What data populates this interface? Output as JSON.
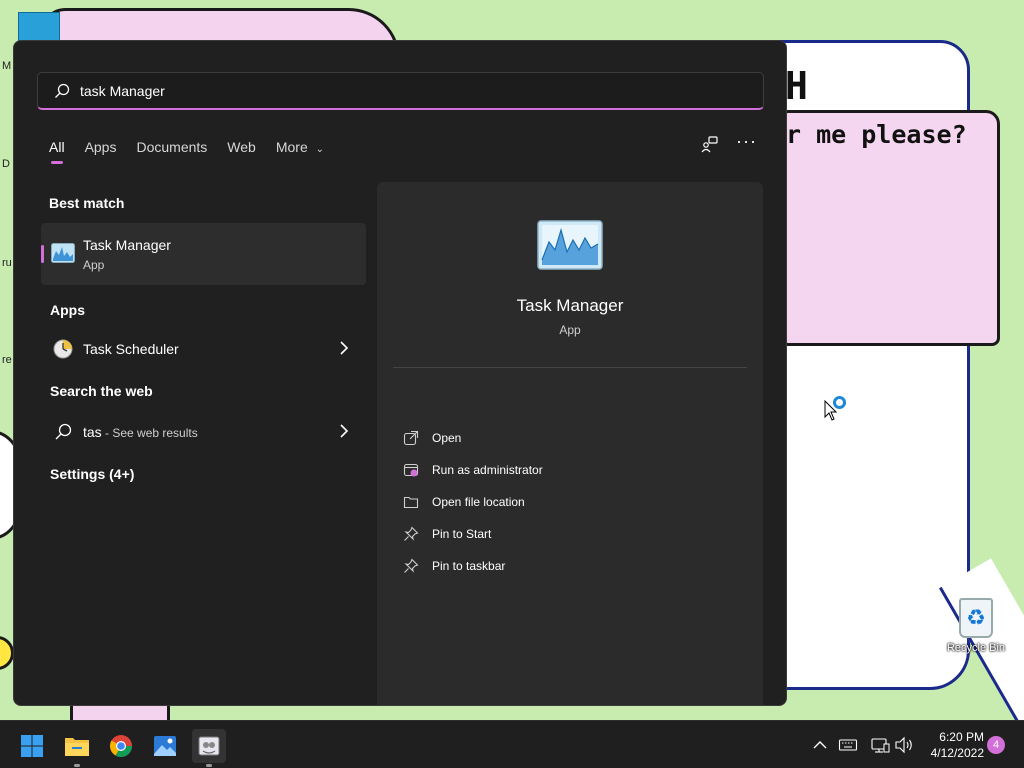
{
  "desktop": {
    "comic_heading": "H",
    "comic_line": "r me please?",
    "edge_letters": [
      "M",
      "D",
      "ru",
      "re"
    ],
    "recycle_bin_label": "Recycle Bin"
  },
  "search": {
    "query": "task Manager"
  },
  "tabs": [
    {
      "label": "All",
      "active": true
    },
    {
      "label": "Apps"
    },
    {
      "label": "Documents"
    },
    {
      "label": "Web"
    },
    {
      "label": "More"
    }
  ],
  "best_match": {
    "heading": "Best match",
    "title": "Task Manager",
    "type": "App"
  },
  "apps": {
    "heading": "Apps",
    "items": [
      {
        "label": "Task Scheduler"
      }
    ]
  },
  "web": {
    "heading": "Search the web",
    "query": "tas",
    "suffix": " - See web results"
  },
  "settings": {
    "heading": "Settings (4+)"
  },
  "detail": {
    "title": "Task Manager",
    "type": "App",
    "actions": [
      {
        "label": "Open",
        "icon": "open-external-icon"
      },
      {
        "label": "Run as administrator",
        "icon": "shield-admin-icon"
      },
      {
        "label": "Open file location",
        "icon": "folder-icon"
      },
      {
        "label": "Pin to Start",
        "icon": "pin-icon"
      },
      {
        "label": "Pin to taskbar",
        "icon": "pin-icon"
      }
    ]
  },
  "taskbar": {
    "apps": [
      "start-icon",
      "file-explorer-icon",
      "chrome-icon",
      "photos-icon",
      "paint-icon"
    ],
    "time": "6:20 PM",
    "date": "4/12/2022",
    "notification_count": "4"
  },
  "colors": {
    "accent": "#d26fd9",
    "panel_bg": "#202020",
    "detail_bg": "#2b2b2b",
    "wallpaper": "#c8ecb0"
  }
}
